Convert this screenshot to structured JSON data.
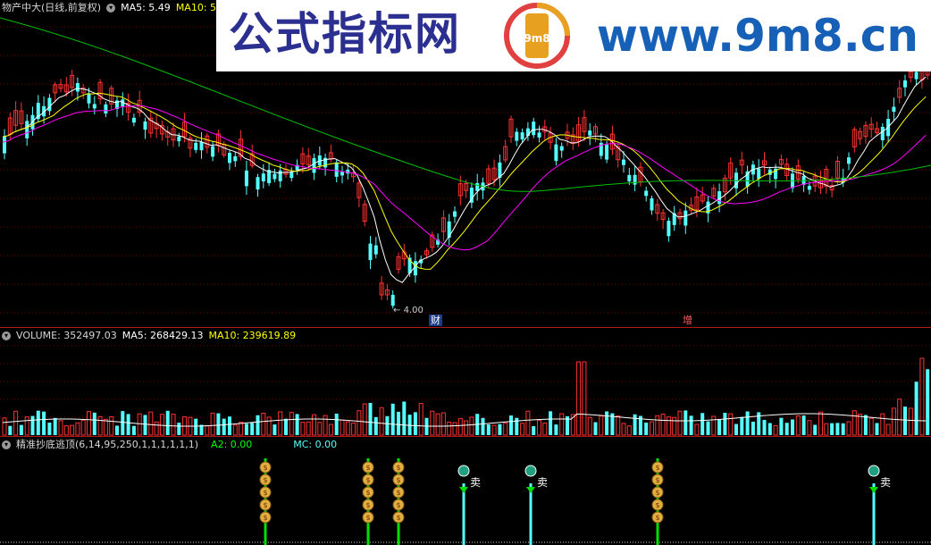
{
  "watermark": {
    "title": "公式指标网",
    "url": "www.9m8.cn",
    "seal_text": "9m8"
  },
  "price_panel": {
    "name": "物产中大(日线,前复权)",
    "ma5": "MA5: 5.49",
    "ma10": "MA10: 5",
    "low_mark": "4.00",
    "tag_cai": "财",
    "tag_zeng": "增",
    "colors": {
      "ma5": "#ffffff",
      "ma10": "#ffff00",
      "ma20": "#ff00ff",
      "ma60": "#00c000",
      "up": "#ff3232",
      "down": "#54ffff",
      "grid": "#7a0000"
    }
  },
  "volume_panel": {
    "label": "VOLUME: 352497.03",
    "ma5": "MA5: 268429.13",
    "ma10": "MA10: 239619.89"
  },
  "indicator_panel": {
    "name": "精准抄底逃顶(6,14,95,250,1,1,1,1,1,1)",
    "a2": "A2: 0.00",
    "mc": "MC: 0.00",
    "sell_label": "卖",
    "money_icon": "money-bag-icon",
    "sell_icon": "sell-arrow-icon"
  }
}
